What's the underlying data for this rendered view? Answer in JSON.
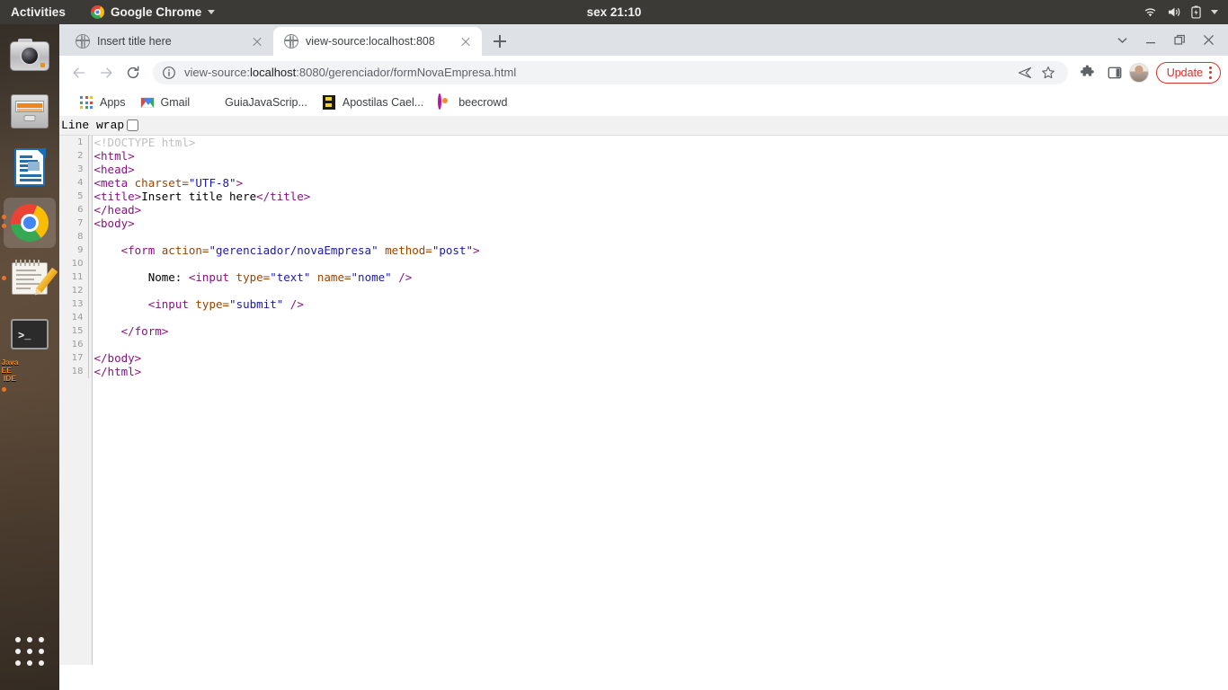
{
  "desktop": {
    "activities": "Activities",
    "app_menu": {
      "name": "Google Chrome",
      "icon": "chrome-logo-icon"
    },
    "clock": "sex 21:10",
    "tray_icons": [
      "wifi-icon",
      "volume-icon",
      "battery-charging-icon",
      "system-menu-caret-icon"
    ],
    "dock": {
      "items": [
        {
          "name": "camera",
          "icon": "camera-icon",
          "running": false,
          "active": false
        },
        {
          "name": "files",
          "icon": "file-cabinet-icon",
          "running": false,
          "active": false
        },
        {
          "name": "libreoffice-writer",
          "icon": "document-icon",
          "running": false,
          "active": false
        },
        {
          "name": "google-chrome",
          "icon": "chrome-icon",
          "running": true,
          "active": true,
          "dots": 2
        },
        {
          "name": "text-editor",
          "icon": "notepad-pencil-icon",
          "running": true,
          "active": false,
          "dots": 1
        },
        {
          "name": "terminal",
          "icon": "terminal-icon",
          "running": false,
          "active": false
        },
        {
          "name": "eclipse-java-ee-ide",
          "icon": "gear-icon",
          "label_line1": "Java EE",
          "label_line2": "IDE",
          "running": true,
          "active": false,
          "dots": 1
        }
      ],
      "show_applications": "show-applications-grid-icon"
    }
  },
  "browser": {
    "tabs": [
      {
        "title": "Insert title here",
        "favicon": "globe-icon",
        "active": false
      },
      {
        "title": "view-source:localhost:808",
        "favicon": "globe-icon",
        "active": true
      }
    ],
    "new_tab_tooltip": "New tab",
    "window_controls": [
      "tab-search-chevron",
      "minimize",
      "maximize",
      "close"
    ],
    "nav": {
      "back": "back-arrow-icon",
      "forward": "forward-arrow-icon",
      "reload": "reload-icon",
      "site_info": "info-circle-icon",
      "url_prefix": "view-source:",
      "url_host": "localhost",
      "url_rest": ":8080/gerenciador/formNovaEmpresa.html",
      "url_full": "view-source:localhost:8080/gerenciador/formNovaEmpresa.html"
    },
    "omnibox_actions": [
      "share-icon",
      "bookmark-star-icon"
    ],
    "toolbar_actions": [
      "extensions-puzzle-icon",
      "side-panel-icon",
      "profile-avatar"
    ],
    "update_button": {
      "label": "Update",
      "color": "#d93025"
    },
    "menu": "three-dot-menu-icon",
    "bookmarks": [
      {
        "label": "Apps",
        "icon": "apps-grid-icon"
      },
      {
        "label": "Gmail",
        "icon": "gmail-icon"
      },
      {
        "label": "GuiaJavaScrip...",
        "icon": "guia-javascript-icon"
      },
      {
        "label": "Apostilas Cael...",
        "icon": "apostilas-caelum-icon"
      },
      {
        "label": "beecrowd",
        "icon": "beecrowd-icon"
      }
    ]
  },
  "page": {
    "line_wrap_label": "Line wrap",
    "line_wrap_checked": false,
    "lines": [
      {
        "n": 1,
        "tokens": [
          {
            "c": "doc",
            "t": "<!DOCTYPE html>"
          }
        ]
      },
      {
        "n": 2,
        "tokens": [
          {
            "c": "tag",
            "t": "<html>"
          }
        ]
      },
      {
        "n": 3,
        "tokens": [
          {
            "c": "tag",
            "t": "<head>"
          }
        ]
      },
      {
        "n": 4,
        "tokens": [
          {
            "c": "tag",
            "t": "<meta "
          },
          {
            "c": "attr",
            "t": "charset="
          },
          {
            "c": "val",
            "t": "\"UTF-8\""
          },
          {
            "c": "tag",
            "t": ">"
          }
        ]
      },
      {
        "n": 5,
        "tokens": [
          {
            "c": "tag",
            "t": "<title>"
          },
          {
            "c": "txt",
            "t": "Insert title here"
          },
          {
            "c": "tag",
            "t": "</title>"
          }
        ]
      },
      {
        "n": 6,
        "tokens": [
          {
            "c": "tag",
            "t": "</head>"
          }
        ]
      },
      {
        "n": 7,
        "tokens": [
          {
            "c": "tag",
            "t": "<body>"
          }
        ]
      },
      {
        "n": 8,
        "tokens": []
      },
      {
        "n": 9,
        "tokens": [
          {
            "c": "txt",
            "t": "    "
          },
          {
            "c": "tag",
            "t": "<form "
          },
          {
            "c": "attr",
            "t": "action="
          },
          {
            "c": "val",
            "t": "\"gerenciador/novaEmpresa\""
          },
          {
            "c": "txt",
            "t": " "
          },
          {
            "c": "attr",
            "t": "method="
          },
          {
            "c": "val",
            "t": "\"post\""
          },
          {
            "c": "tag",
            "t": ">"
          }
        ]
      },
      {
        "n": 10,
        "tokens": []
      },
      {
        "n": 11,
        "tokens": [
          {
            "c": "txt",
            "t": "        Nome: "
          },
          {
            "c": "tag",
            "t": "<input "
          },
          {
            "c": "attr",
            "t": "type="
          },
          {
            "c": "val",
            "t": "\"text\""
          },
          {
            "c": "txt",
            "t": " "
          },
          {
            "c": "attr",
            "t": "name="
          },
          {
            "c": "val",
            "t": "\"nome\""
          },
          {
            "c": "tag",
            "t": " />"
          }
        ]
      },
      {
        "n": 12,
        "tokens": []
      },
      {
        "n": 13,
        "tokens": [
          {
            "c": "txt",
            "t": "        "
          },
          {
            "c": "tag",
            "t": "<input "
          },
          {
            "c": "attr",
            "t": "type="
          },
          {
            "c": "val",
            "t": "\"submit\""
          },
          {
            "c": "tag",
            "t": " />"
          }
        ]
      },
      {
        "n": 14,
        "tokens": []
      },
      {
        "n": 15,
        "tokens": [
          {
            "c": "txt",
            "t": "    "
          },
          {
            "c": "tag",
            "t": "</form>"
          }
        ]
      },
      {
        "n": 16,
        "tokens": []
      },
      {
        "n": 17,
        "tokens": [
          {
            "c": "tag",
            "t": "</body>"
          }
        ]
      },
      {
        "n": 18,
        "tokens": [
          {
            "c": "tag",
            "t": "</html>"
          }
        ]
      }
    ]
  }
}
